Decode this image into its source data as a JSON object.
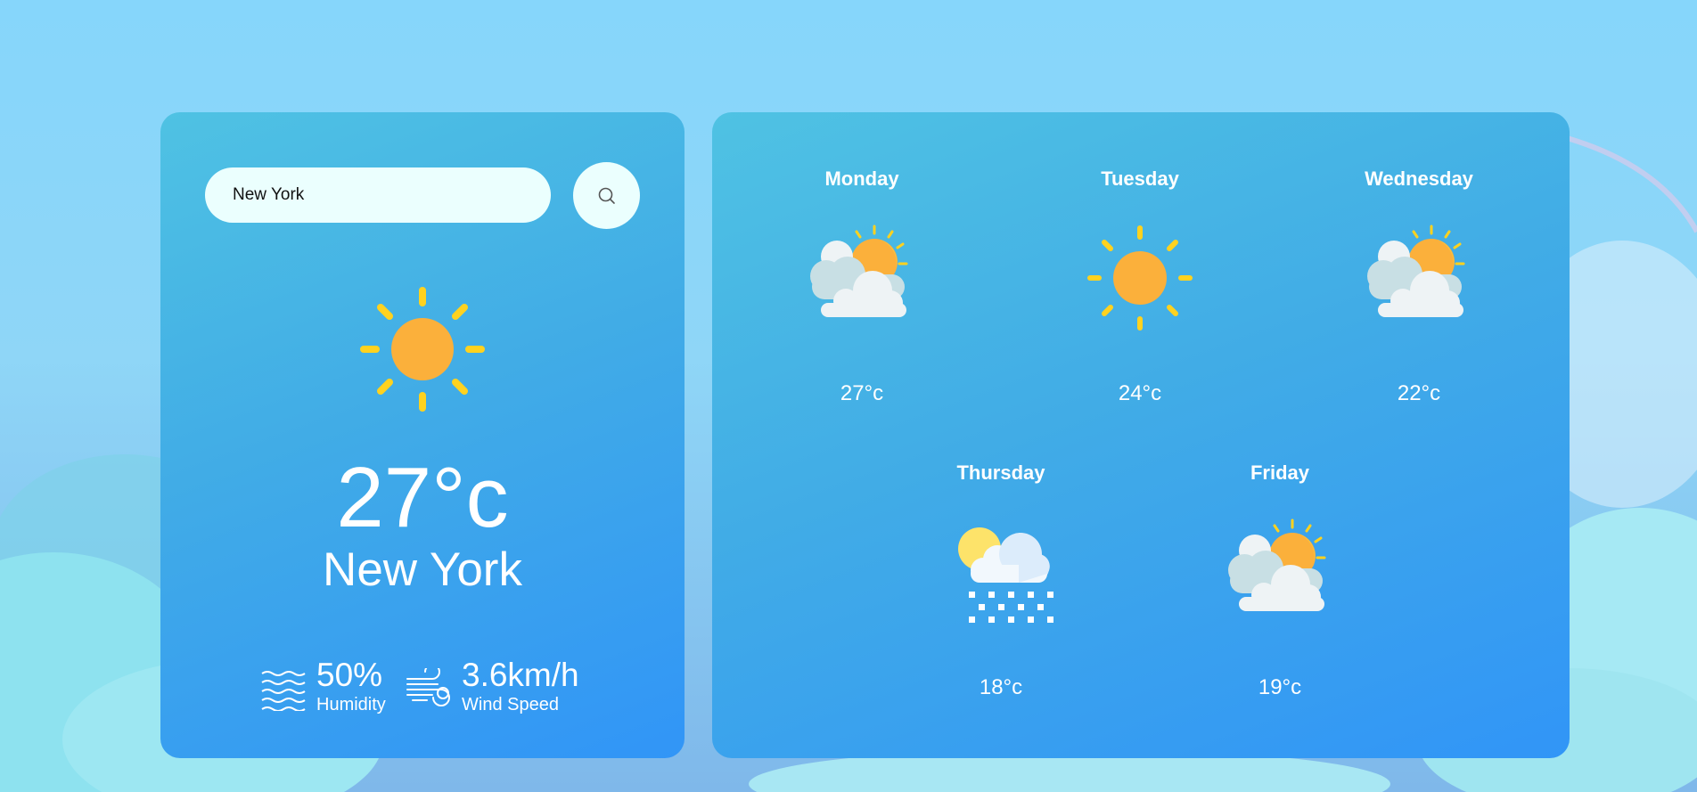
{
  "search": {
    "value": "New York",
    "button_icon": "search-icon"
  },
  "current": {
    "icon": "sun-icon",
    "temperature": "27°c",
    "city": "New York",
    "humidity": {
      "icon": "humidity-icon",
      "value": "50%",
      "label": "Humidity"
    },
    "wind": {
      "icon": "wind-icon",
      "value": "3.6km/h",
      "label": "Wind Speed"
    }
  },
  "forecast": [
    {
      "day": "Monday",
      "icon": "cloudy-sun-icon",
      "temp": "27°c"
    },
    {
      "day": "Tuesday",
      "icon": "sun-icon",
      "temp": "24°c"
    },
    {
      "day": "Wednesday",
      "icon": "cloudy-sun-icon",
      "temp": "22°c"
    },
    {
      "day": "Thursday",
      "icon": "snow-cloud-icon",
      "temp": "18°c"
    },
    {
      "day": "Friday",
      "icon": "cloudy-sun-icon",
      "temp": "19°c"
    }
  ],
  "colors": {
    "card_gradient_start": "#4fc2e3",
    "card_gradient_end": "#3195f7",
    "sun_body": "#fbb03b",
    "sun_rays": "#ffd21f",
    "input_background": "#ebfffe"
  }
}
